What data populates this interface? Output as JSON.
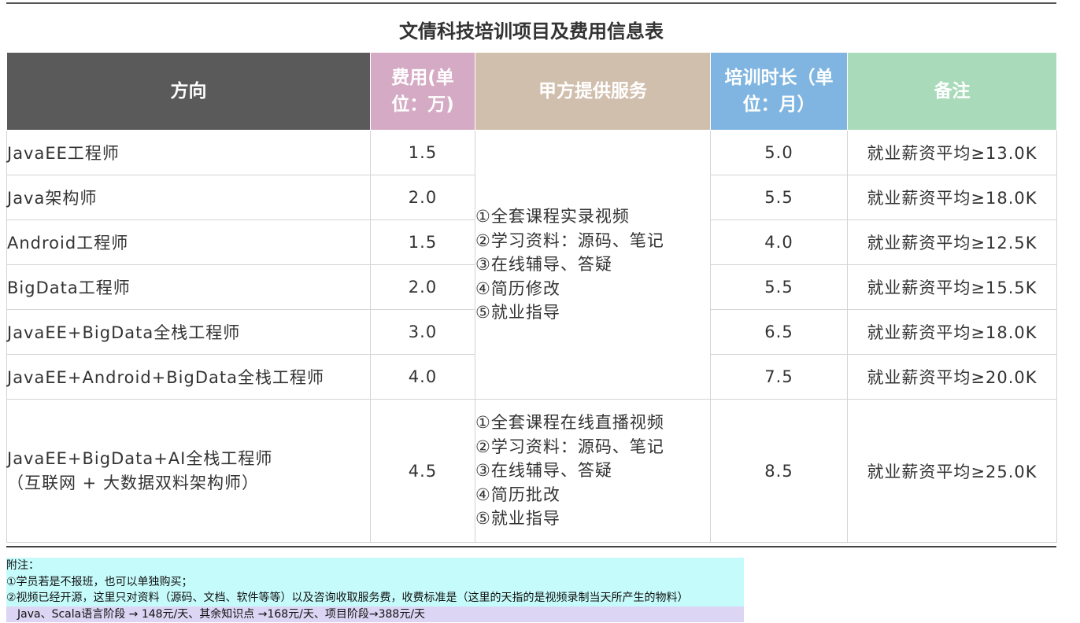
{
  "title": "文倩科技培训项目及费用信息表",
  "headers": {
    "direction": "方向",
    "fee": "费用(单位：万)",
    "service": "甲方提供服务",
    "duration": "培训时长（单位：月）",
    "remark": "备注"
  },
  "rows": [
    {
      "direction": "JavaEE工程师",
      "fee": "1.5",
      "duration": "5.0",
      "remark": "就业薪资平均≥13.0K"
    },
    {
      "direction": "Java架构师",
      "fee": "2.0",
      "duration": "5.5",
      "remark": "就业薪资平均≥18.0K"
    },
    {
      "direction": "Android工程师",
      "fee": "1.5",
      "duration": "4.0",
      "remark": "就业薪资平均≥12.5K"
    },
    {
      "direction": "BigData工程师",
      "fee": "2.0",
      "duration": "5.5",
      "remark": "就业薪资平均≥15.5K"
    },
    {
      "direction": "JavaEE+BigData全栈工程师",
      "fee": "3.0",
      "duration": "6.5",
      "remark": "就业薪资平均≥18.0K"
    },
    {
      "direction": "JavaEE+Android+BigData全栈工程师",
      "fee": "4.0",
      "duration": "7.5",
      "remark": "就业薪资平均≥20.0K"
    },
    {
      "direction": "JavaEE+BigData+AI全栈工程师",
      "direction_sub": "（互联网 + 大数据双料架构师）",
      "fee": "4.5",
      "duration": "8.5",
      "remark": "就业薪资平均≥25.0K"
    }
  ],
  "services_group1": [
    "①全套课程实录视频",
    "②学习资料：源码、笔记",
    "③在线辅导、答疑",
    "④简历修改",
    "⑤就业指导"
  ],
  "services_group2": [
    "①全套课程在线直播视频",
    "②学习资料：源码、笔记",
    "③在线辅导、答疑",
    "④简历批改",
    "⑤就业指导"
  ],
  "footnote": {
    "heading": "附注：",
    "line1": "①学员若是不报班，也可以单独购买；",
    "line2": "②视频已经开源，这里只对资料（源码、文档、软件等等）以及咨询收取服务费，收费标准是（这里的天指的是视频录制当天所产生的物料）",
    "line3": "Java、Scala语言阶段 → 148元/天、其余知识点 →168元/天、项目阶段→388元/天"
  },
  "colors": {
    "header_direction": "#5a5a5a",
    "header_fee": "#d5aac4",
    "header_service": "#d1bfae",
    "header_duration": "#7fb5e0",
    "header_remark": "#a9dbba",
    "footnote_bg": "#c6fbfb",
    "footnote_alt_bg": "#dcd5f3"
  }
}
